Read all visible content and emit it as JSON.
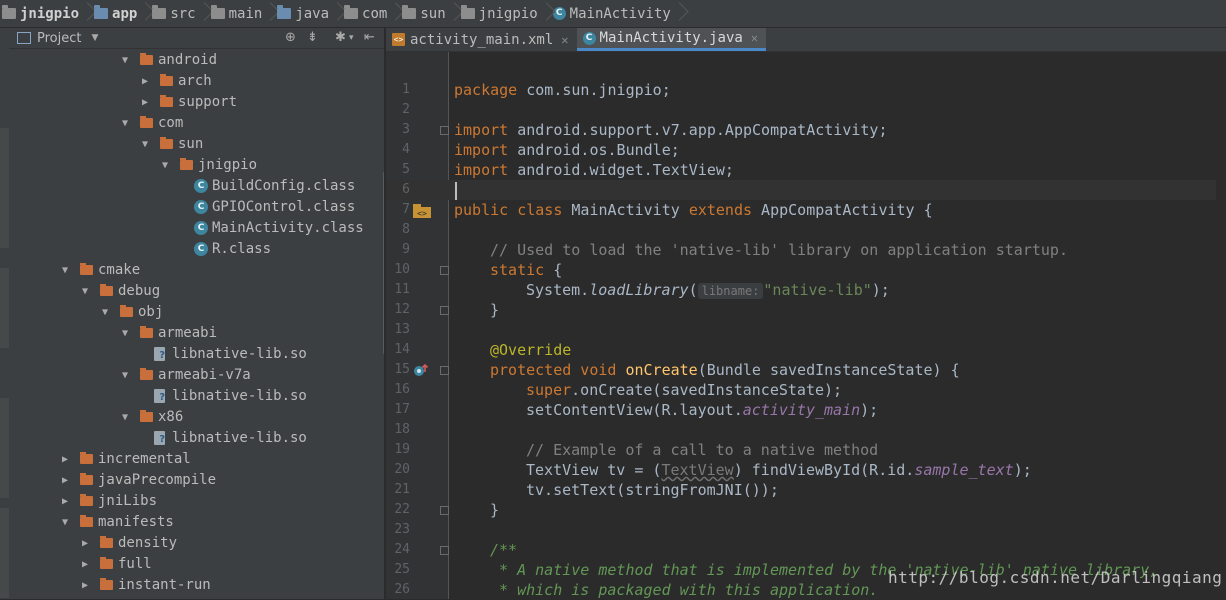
{
  "breadcrumb": {
    "items": [
      "jnigpio",
      "app",
      "src",
      "main",
      "java",
      "com",
      "sun",
      "jnigpio",
      "MainActivity"
    ]
  },
  "project_panel": {
    "title": "Project",
    "tree": [
      {
        "label": "android",
        "type": "folder",
        "expanded": true
      },
      {
        "label": "arch",
        "type": "folder",
        "expanded": false
      },
      {
        "label": "support",
        "type": "folder",
        "expanded": false
      },
      {
        "label": "com",
        "type": "folder",
        "expanded": true
      },
      {
        "label": "sun",
        "type": "folder",
        "expanded": true
      },
      {
        "label": "jnigpio",
        "type": "folder",
        "expanded": true
      },
      {
        "label": "BuildConfig.class",
        "type": "class"
      },
      {
        "label": "GPIOControl.class",
        "type": "class"
      },
      {
        "label": "MainActivity.class",
        "type": "class"
      },
      {
        "label": "R.class",
        "type": "class"
      },
      {
        "label": "cmake",
        "type": "folder",
        "expanded": true
      },
      {
        "label": "debug",
        "type": "folder",
        "expanded": true
      },
      {
        "label": "obj",
        "type": "folder",
        "expanded": true
      },
      {
        "label": "armeabi",
        "type": "folder",
        "expanded": true
      },
      {
        "label": "libnative-lib.so",
        "type": "so"
      },
      {
        "label": "armeabi-v7a",
        "type": "folder",
        "expanded": true
      },
      {
        "label": "libnative-lib.so",
        "type": "so"
      },
      {
        "label": "x86",
        "type": "folder",
        "expanded": true
      },
      {
        "label": "libnative-lib.so",
        "type": "so"
      },
      {
        "label": "incremental",
        "type": "folder",
        "expanded": false
      },
      {
        "label": "javaPrecompile",
        "type": "folder",
        "expanded": false
      },
      {
        "label": "jniLibs",
        "type": "folder",
        "expanded": false
      },
      {
        "label": "manifests",
        "type": "folder",
        "expanded": true
      },
      {
        "label": "density",
        "type": "folder",
        "expanded": false
      },
      {
        "label": "full",
        "type": "folder",
        "expanded": false
      },
      {
        "label": "instant-run",
        "type": "folder",
        "expanded": false
      }
    ]
  },
  "tabs": [
    {
      "label": "activity_main.xml",
      "active": false
    },
    {
      "label": "MainActivity.java",
      "active": true
    }
  ],
  "editor": {
    "line_numbers": [
      "1",
      "2",
      "3",
      "4",
      "5",
      "6",
      "7",
      "8",
      "9",
      "10",
      "11",
      "12",
      "13",
      "14",
      "15",
      "16",
      "17",
      "18",
      "19",
      "20",
      "21",
      "22",
      "23",
      "24",
      "25",
      "26"
    ],
    "hint_libname": "libname:",
    "lines": {
      "l1": {
        "kw": "package",
        "rest": " com.sun.jnigpio;"
      },
      "l3": {
        "kw": "import",
        "rest": " android.support.v7.app.AppCompatActivity;"
      },
      "l4": {
        "kw": "import",
        "rest": " android.os.Bundle;"
      },
      "l5": {
        "kw": "import",
        "rest": " android.widget.TextView;"
      },
      "l7": {
        "kw1": "public class",
        "name": " MainActivity ",
        "kw2": "extends",
        "rest": " AppCompatActivity {"
      },
      "l9": "// Used to load the 'native-lib' library on application startup.",
      "l10": {
        "kw": "static",
        "rest": " {"
      },
      "l11": {
        "pre": "System.",
        "method": "loadLibrary",
        "open": "(",
        "str": "\"native-lib\"",
        "close": ");"
      },
      "l12": "}",
      "l14": "@Override",
      "l15": {
        "kw": "protected void",
        "fn": " onCreate",
        "rest": "(Bundle savedInstanceState) {"
      },
      "l16": {
        "kw": "super",
        "rest": ".onCreate(savedInstanceState);"
      },
      "l17": {
        "pre": "setContentView(R.layout.",
        "field": "activity_main",
        "post": ");"
      },
      "l19": "// Example of a call to a native method",
      "l20": {
        "pre": "TextView tv = (",
        "cast": "TextView",
        "mid": ") findViewById(R.id.",
        "field": "sample_text",
        "post": ");"
      },
      "l21": "tv.setText(stringFromJNI());",
      "l22": "}",
      "l24": "/**",
      "l25": " * A native method that is implemented by the 'native-lib' native library,",
      "l26": " * which is packaged with this application."
    }
  },
  "watermark": "http://blog.csdn.net/Darlingqiang"
}
